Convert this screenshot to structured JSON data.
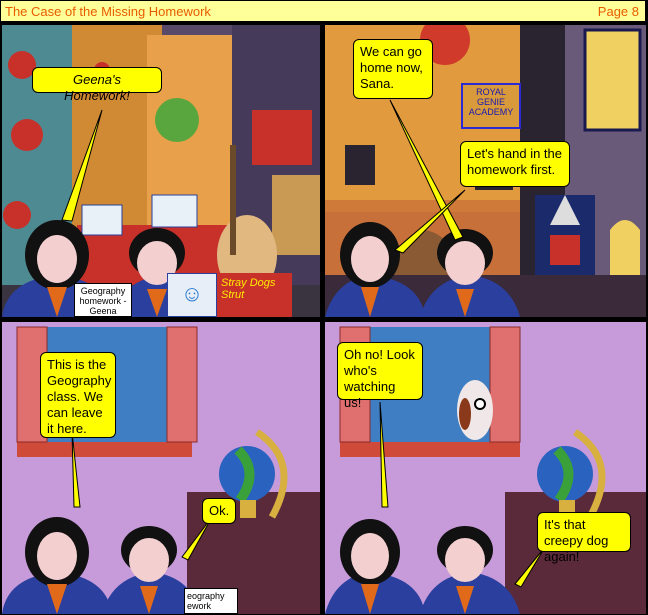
{
  "header": {
    "title": "The Case of the Missing Homework",
    "page_label": "Page 8"
  },
  "panels": [
    {
      "speech": [
        "Geena's Homework!"
      ],
      "label_homework": "Geography homework - Geena",
      "poster_text": "Stray Dogs Strut"
    },
    {
      "speech": [
        "We can go home now, Sana.",
        "Let's hand in the homework first."
      ],
      "sign": "ROYAL GENIE ACADEMY"
    },
    {
      "speech": [
        "This is the Geography class. We can leave it here.",
        "Ok."
      ],
      "label_partial": "eography ework"
    },
    {
      "speech": [
        "Oh no! Look who's watching us!",
        "It's that creepy dog again!"
      ]
    }
  ],
  "colors": {
    "bubble": "#ffff00",
    "title_bar": "#ffff99",
    "title_text": "#e85c00",
    "uniform_blue": "#2a3f9e",
    "wall_purple": "#c79ad9"
  }
}
